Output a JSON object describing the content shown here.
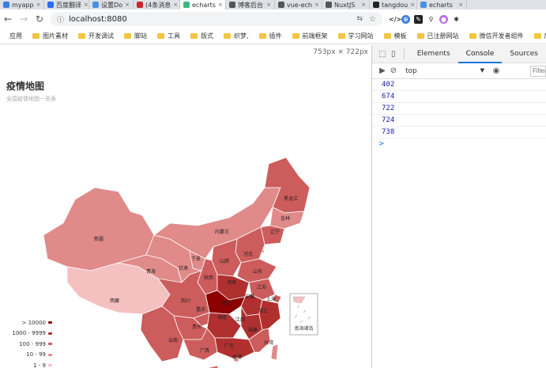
{
  "tabs": [
    {
      "title": "myapp",
      "color": "#3c7fd9",
      "active": false
    },
    {
      "title": "百度翻译",
      "color": "#2a6ef5",
      "active": false
    },
    {
      "title": "设置Do",
      "color": "#4a90e2",
      "active": false
    },
    {
      "title": "(4条消息",
      "color": "#c8282d",
      "active": false
    },
    {
      "title": "echarts",
      "color": "#41b883",
      "active": true
    },
    {
      "title": "博客后台",
      "color": "#555555",
      "active": false
    },
    {
      "title": "vue-ech",
      "color": "#555555",
      "active": false
    },
    {
      "title": "NuxtJS",
      "color": "#555555",
      "active": false
    },
    {
      "title": "tangdou",
      "color": "#222222",
      "active": false
    },
    {
      "title": "echarts",
      "color": "#4a90e2",
      "active": false
    }
  ],
  "toolbar": {
    "url": "localhost:8080"
  },
  "bookmarks": {
    "apps_label": "应用",
    "items": [
      "图片素材",
      "开发调试",
      "脚站",
      "工具",
      "版式",
      "织梦,",
      "插件",
      "前端框架",
      "学习网站",
      "模板",
      "已注册网站",
      "微信开发者组件",
      "后台管理"
    ]
  },
  "viewport": {
    "size_badge": "753px × 722px"
  },
  "map": {
    "title": "疫情地图",
    "subtitle": "全国疫情地图一览表",
    "legend": [
      {
        "label": "> 10000",
        "color": "#8b0000"
      },
      {
        "label": "1000 - 9999",
        "color": "#b03030"
      },
      {
        "label": "100 - 999",
        "color": "#cd5c5c"
      },
      {
        "label": "10 - 99",
        "color": "#e08a8a"
      },
      {
        "label": "1 - 9",
        "color": "#f5c0c0"
      }
    ],
    "provinces": [
      {
        "name": "新疆",
        "level": 3,
        "color": "#e08a8a"
      },
      {
        "name": "西藏",
        "level": 4,
        "color": "#f5c0c0"
      },
      {
        "name": "青海",
        "level": 3,
        "color": "#e08a8a"
      },
      {
        "name": "甘肃",
        "level": 3,
        "color": "#e08a8a"
      },
      {
        "name": "内蒙古",
        "level": 3,
        "color": "#e08a8a"
      },
      {
        "name": "黑龙江",
        "level": 2,
        "color": "#cd5c5c"
      },
      {
        "name": "吉林",
        "level": 3,
        "color": "#e08a8a"
      },
      {
        "name": "辽宁",
        "level": 2,
        "color": "#cd5c5c"
      },
      {
        "name": "北京",
        "level": 2,
        "color": "#cd5c5c"
      },
      {
        "name": "天津",
        "level": 2,
        "color": "#cd5c5c"
      },
      {
        "name": "河北",
        "level": 2,
        "color": "#cd5c5c"
      },
      {
        "name": "山西",
        "level": 2,
        "color": "#cd5c5c"
      },
      {
        "name": "宁夏",
        "level": 3,
        "color": "#e08a8a"
      },
      {
        "name": "陕西",
        "level": 2,
        "color": "#cd5c5c"
      },
      {
        "name": "山东",
        "level": 2,
        "color": "#cd5c5c"
      },
      {
        "name": "河南",
        "level": 1,
        "color": "#b03030"
      },
      {
        "name": "江苏",
        "level": 2,
        "color": "#cd5c5c"
      },
      {
        "name": "安徽",
        "level": 1,
        "color": "#b03030"
      },
      {
        "name": "上海",
        "level": 2,
        "color": "#cd5c5c"
      },
      {
        "name": "湖北",
        "level": 0,
        "color": "#8b0000"
      },
      {
        "name": "四川",
        "level": 2,
        "color": "#cd5c5c"
      },
      {
        "name": "重庆",
        "level": 2,
        "color": "#cd5c5c"
      },
      {
        "name": "湖南",
        "level": 1,
        "color": "#b03030"
      },
      {
        "name": "江西",
        "level": 1,
        "color": "#b03030"
      },
      {
        "name": "浙江",
        "level": 1,
        "color": "#b03030"
      },
      {
        "name": "贵州",
        "level": 2,
        "color": "#cd5c5c"
      },
      {
        "name": "云南",
        "level": 2,
        "color": "#cd5c5c"
      },
      {
        "name": "广西",
        "level": 2,
        "color": "#cd5c5c"
      },
      {
        "name": "广东",
        "level": 1,
        "color": "#b03030"
      },
      {
        "name": "福建",
        "level": 2,
        "color": "#cd5c5c"
      },
      {
        "name": "台湾",
        "level": 3,
        "color": "#e08a8a"
      },
      {
        "name": "香港",
        "level": 3,
        "color": "#e08a8a"
      },
      {
        "name": "海南",
        "level": 2,
        "color": "#cd5c5c"
      }
    ],
    "inset_label": "南海诸岛"
  },
  "devtools": {
    "tabs": [
      "Elements",
      "Console",
      "Sources"
    ],
    "active_tab": "Console",
    "context": "top",
    "filter_placeholder": "Filter",
    "logs": [
      "402",
      "674",
      "722",
      "724",
      "738"
    ],
    "prompt": ">"
  }
}
